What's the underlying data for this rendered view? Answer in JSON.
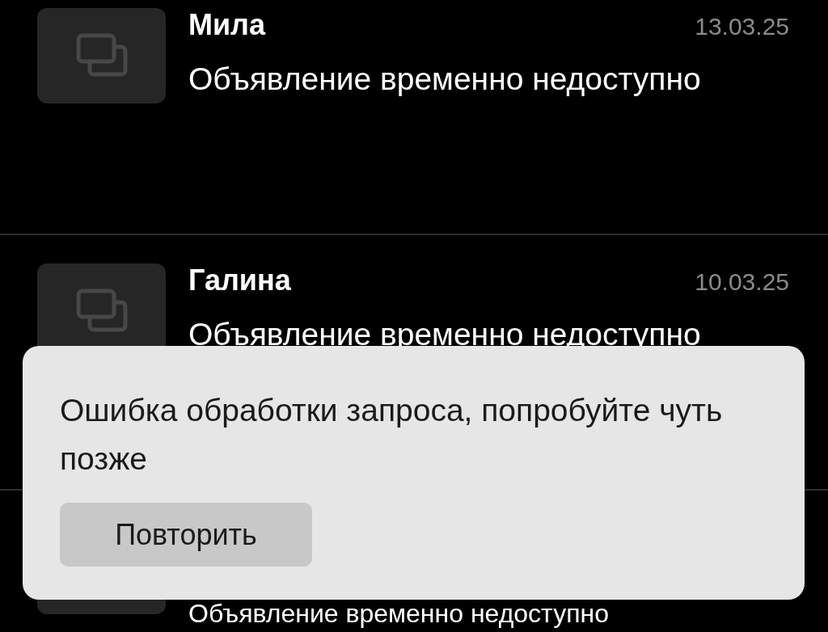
{
  "chats": [
    {
      "name": "Мила",
      "date": "13.03.25",
      "message": "Объявление временно недоступно"
    },
    {
      "name": "Галина",
      "date": "10.03.25",
      "message": "Объявление временно недоступно"
    },
    {
      "message": "Объявление временно недоступно"
    }
  ],
  "snackbar": {
    "message": "Ошибка обработки запроса, попробуйте чуть позже",
    "action": "Повторить"
  }
}
